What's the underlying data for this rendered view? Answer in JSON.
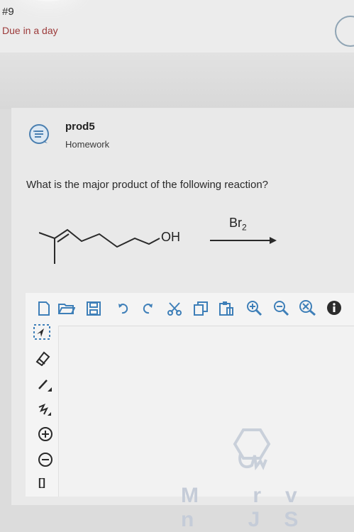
{
  "header": {
    "assignment_number": "#9",
    "due_text": "Due in a day"
  },
  "question_card": {
    "title": "prod5",
    "subtitle": "Homework",
    "prompt": "What is the major product of the following reaction?"
  },
  "reaction": {
    "reactant_label": "OH",
    "reagent": "Br",
    "reagent_subscript": "2"
  },
  "toolbar": {
    "items": [
      "new-document-icon",
      "open-folder-icon",
      "save-icon",
      "undo-icon",
      "redo-icon",
      "cut-icon",
      "copy-icon",
      "paste-icon",
      "zoom-in-icon",
      "zoom-out-icon",
      "zoom-reset-icon",
      "info-icon"
    ]
  },
  "left_tools": {
    "items": [
      "select-icon",
      "eraser-icon",
      "bond-icon",
      "chain-icon",
      "charge-plus-icon",
      "charge-minus-icon",
      "bracket-icon"
    ],
    "bracket_label": "[]"
  },
  "watermark": {
    "text": "M  rv  n  JS"
  },
  "colors": {
    "due": "#9c3a3a",
    "icon_blue": "#3e7fb8",
    "accent_gray": "#4a4a4a"
  }
}
